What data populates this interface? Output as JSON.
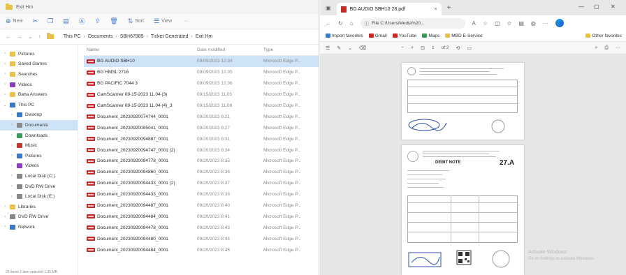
{
  "explorer": {
    "title": "Exit Hm",
    "toolbar": [
      {
        "icon": "new-icon",
        "label": "New"
      },
      {
        "icon": "cut-icon",
        "label": ""
      },
      {
        "icon": "copy-icon",
        "label": ""
      },
      {
        "icon": "paste-icon",
        "label": ""
      },
      {
        "icon": "rename-icon",
        "label": ""
      },
      {
        "icon": "share-icon",
        "label": ""
      },
      {
        "icon": "delete-icon",
        "label": ""
      },
      {
        "icon": "sort-icon",
        "label": "Sort"
      },
      {
        "icon": "view-icon",
        "label": "View"
      },
      {
        "icon": "more-icon",
        "label": "···"
      }
    ],
    "breadcrumb": [
      "This PC",
      "Documents",
      "SBH67889",
      "Ticket Generated",
      "Exit Hm"
    ],
    "nav": [
      {
        "label": "Pictures",
        "color": "#e8c14a"
      },
      {
        "label": "Saved Games",
        "color": "#e8c14a"
      },
      {
        "label": "Searches",
        "color": "#e8c14a"
      },
      {
        "label": "Videos",
        "color": "#8a3fbf"
      },
      {
        "label": "Baha Answers",
        "color": "#e8c14a"
      },
      {
        "label": "This PC",
        "color": "#3a78c8"
      },
      {
        "label": "Desktop",
        "color": "#3a78c8"
      },
      {
        "label": "Documents",
        "color": "#8a8a8a"
      },
      {
        "label": "Downloads",
        "color": "#3a9a5a"
      },
      {
        "label": "Music",
        "color": "#c0392b"
      },
      {
        "label": "Pictures",
        "color": "#3a78c8"
      },
      {
        "label": "Videos",
        "color": "#8a3fbf"
      },
      {
        "label": "Local Disk (C:)",
        "color": "#888888"
      },
      {
        "label": "DVD RW Drive",
        "color": "#888888"
      },
      {
        "label": "Local Disk (E:)",
        "color": "#888888"
      },
      {
        "label": "Libraries",
        "color": "#e8c14a"
      },
      {
        "label": "DVD RW Drive",
        "color": "#888888"
      },
      {
        "label": "Network",
        "color": "#3a78c8"
      }
    ],
    "columns": {
      "name": "Name",
      "date": "Date modified",
      "type": "Type"
    },
    "files": [
      {
        "name": "BG AUDIO SBH10",
        "date": "09/09/2023 12:34",
        "type": "Microsoft Edge P..."
      },
      {
        "name": "BG HMSL 2716",
        "date": "09/09/2023 12:35",
        "type": "Microsoft Edge P..."
      },
      {
        "name": "BG PACIFIC 7044 3",
        "date": "09/09/2023 12:36",
        "type": "Microsoft Edge P..."
      },
      {
        "name": "CamScanner 09-15-2023 11.04 (3)",
        "date": "09/15/2023 11:05",
        "type": "Microsoft Edge P..."
      },
      {
        "name": "CamScanner 09-15-2023 11.04 (4)_3",
        "date": "09/15/2023 11:06",
        "type": "Microsoft Edge P..."
      },
      {
        "name": "Document_20230920074744_0001",
        "date": "09/20/2023 8:21",
        "type": "Microsoft Edge P..."
      },
      {
        "name": "Document_20230920085041_0001",
        "date": "09/20/2023 8:27",
        "type": "Microsoft Edge P..."
      },
      {
        "name": "Document_20230920094887_0001",
        "date": "09/20/2023 8:31",
        "type": "Microsoft Edge P..."
      },
      {
        "name": "Document_20230920094747_0001 (2)",
        "date": "09/20/2023 8:34",
        "type": "Microsoft Edge P..."
      },
      {
        "name": "Document_20230920094778_0001",
        "date": "09/20/2023 8:35",
        "type": "Microsoft Edge P..."
      },
      {
        "name": "Document_20230920094860_0001",
        "date": "09/20/2023 8:36",
        "type": "Microsoft Edge P..."
      },
      {
        "name": "Document_20230920094433_0001 (2)",
        "date": "09/20/2023 8:37",
        "type": "Microsoft Edge P..."
      },
      {
        "name": "Document_20230920094433_0001",
        "date": "09/20/2023 8:38",
        "type": "Microsoft Edge P..."
      },
      {
        "name": "Document_20230920094487_0001",
        "date": "09/20/2023 8:40",
        "type": "Microsoft Edge P..."
      },
      {
        "name": "Document_20230920094484_0001",
        "date": "09/20/2023 8:41",
        "type": "Microsoft Edge P..."
      },
      {
        "name": "Document_20230920094478_0001",
        "date": "09/20/2023 8:43",
        "type": "Microsoft Edge P..."
      },
      {
        "name": "Document_20230920094480_0001",
        "date": "09/20/2023 8:44",
        "type": "Microsoft Edge P..."
      },
      {
        "name": "Document_20230920094484_0001",
        "date": "09/20/2023 8:45",
        "type": "Microsoft Edge P..."
      }
    ],
    "status": "25 items   1 item selected 1.35 MB"
  },
  "edge": {
    "tab_title": "BG AUDIO SBH10 28.pdf",
    "address": "File  C:/Users/Media%20...",
    "favorites": [
      {
        "label": "Import favorites",
        "color": "#3a78c8"
      },
      {
        "label": "Gmail",
        "color": "#c62828"
      },
      {
        "label": "YouTube",
        "color": "#c62828"
      },
      {
        "label": "Maps",
        "color": "#3a9a5a"
      },
      {
        "label": "MBD E-Service",
        "color": "#e8c14a"
      },
      {
        "label": "Other favorites",
        "color": "#e8c14a"
      }
    ],
    "pdf_toolbar": {
      "page": "1",
      "page_count": "of 2"
    },
    "document": {
      "heading": "DEBIT NOTE",
      "code": "27.A"
    },
    "watermark": [
      "Activate Windows",
      "Go to Settings to activate Windows."
    ]
  }
}
